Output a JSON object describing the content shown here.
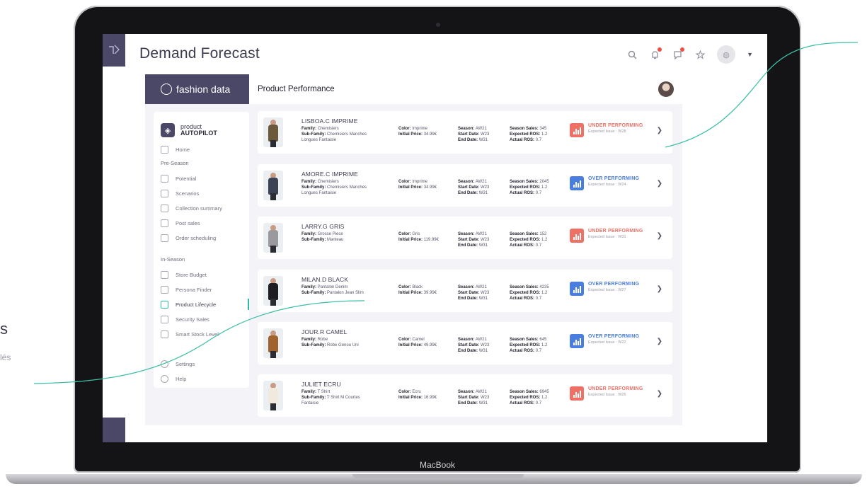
{
  "background": {
    "left_heading": "s",
    "left_sub": "lés"
  },
  "device": {
    "label": "MacBook"
  },
  "app": {
    "title": "Demand Forecast",
    "brand": "fashion data",
    "page_title": "Product Performance"
  },
  "sidebar": {
    "brand_line1": "product",
    "brand_line2": "AUTOPILOT",
    "home": "Home",
    "section_pre": "Pre-Season",
    "pre_items": [
      "Potential",
      "Scenarios",
      "Collection summary",
      "Post sales",
      "Order scheduling"
    ],
    "section_in": "In-Season",
    "in_items": [
      "Store Budget",
      "Persona Finder",
      "Product Lifecycle",
      "Security Sales",
      "Smart Stock Level"
    ],
    "settings": "Settings",
    "help": "Help"
  },
  "labels": {
    "family": "Family:",
    "sub_family": "Sub-Family:",
    "color": "Color:",
    "initial_price": "Initial Price:",
    "season": "Season:",
    "start_date": "Start Date:",
    "end_date": "End Date:",
    "season_sales": "Season Sales:",
    "expected_ros": "Expected ROS:",
    "actual_ros": "Actual ROS:"
  },
  "colors": {
    "primary": "#4b4766",
    "accent": "#34b8a3",
    "under": "#ef7165",
    "over": "#4a7de0"
  },
  "products": [
    {
      "name": "LISBOA.C IMPRIME",
      "family": "Chemisiers",
      "sub_family": "Chemisiers Manches",
      "sub_family_2": "Longues Fantaisie",
      "color": "Imprime",
      "initial_price": "34.99€",
      "season": "AW21",
      "start_date": "W23",
      "end_date": "W31",
      "season_sales": "345",
      "expected_ros": "1.2",
      "actual_ros": "0.7",
      "status": "UNDER PERFORMING",
      "status_type": "under",
      "expected_issue": "Expected Issue : W28",
      "swatch": "#6b5a3c"
    },
    {
      "name": "AMORE.C IMPRIME",
      "family": "Chemisiers",
      "sub_family": "Chemisiers Manches",
      "sub_family_2": "Longues Fantaisie",
      "color": "Imprime",
      "initial_price": "34.99€",
      "season": "AW21",
      "start_date": "W23",
      "end_date": "W31",
      "season_sales": "2045",
      "expected_ros": "1.2",
      "actual_ros": "0.7",
      "status": "OVER PERFORMING",
      "status_type": "over",
      "expected_issue": "Expected Issue : W24",
      "swatch": "#3b4253"
    },
    {
      "name": "LARRY.G GRIS",
      "family": "Grosse Piece",
      "sub_family": "Manteau",
      "sub_family_2": "",
      "color": "Gris",
      "initial_price": "119.99€",
      "season": "AW21",
      "start_date": "W23",
      "end_date": "W31",
      "season_sales": "152",
      "expected_ros": "1.2",
      "actual_ros": "0.7",
      "status": "UNDER PERFORMING",
      "status_type": "under",
      "expected_issue": "Expected Issue : W31",
      "swatch": "#9a9a9e"
    },
    {
      "name": "MILAN.D BLACK",
      "family": "Pantalon Denim",
      "sub_family": "Pantalon Jean Slim",
      "sub_family_2": "",
      "color": "Black",
      "initial_price": "39.99€",
      "season": "AW21",
      "start_date": "W23",
      "end_date": "W31",
      "season_sales": "4235",
      "expected_ros": "1.2",
      "actual_ros": "0.7",
      "status": "OVER PERFORMING",
      "status_type": "over",
      "expected_issue": "Expected Issue : W27",
      "swatch": "#1e1e22"
    },
    {
      "name": "JOUR.R CAMEL",
      "family": "Robe",
      "sub_family": "Robe Genou Uni",
      "sub_family_2": "",
      "color": "Camel",
      "initial_price": "49.99€",
      "season": "AW21",
      "start_date": "W23",
      "end_date": "W31",
      "season_sales": "645",
      "expected_ros": "1.2",
      "actual_ros": "0.7",
      "status": "OVER PERFORMING",
      "status_type": "over",
      "expected_issue": "Expected Issue : W22",
      "swatch": "#a0622e"
    },
    {
      "name": "JULIET ECRU",
      "family": "T Shirt",
      "sub_family": "T Shirt M Courtes",
      "sub_family_2": "Fantaisie",
      "color": "Ecru",
      "initial_price": "16.99€",
      "season": "AW21",
      "start_date": "W23",
      "end_date": "W31",
      "season_sales": "6945",
      "expected_ros": "1.2",
      "actual_ros": "0.7",
      "status": "UNDER PERFORMING",
      "status_type": "under",
      "expected_issue": "Expected Issue : W26",
      "swatch": "#efe9de"
    }
  ]
}
